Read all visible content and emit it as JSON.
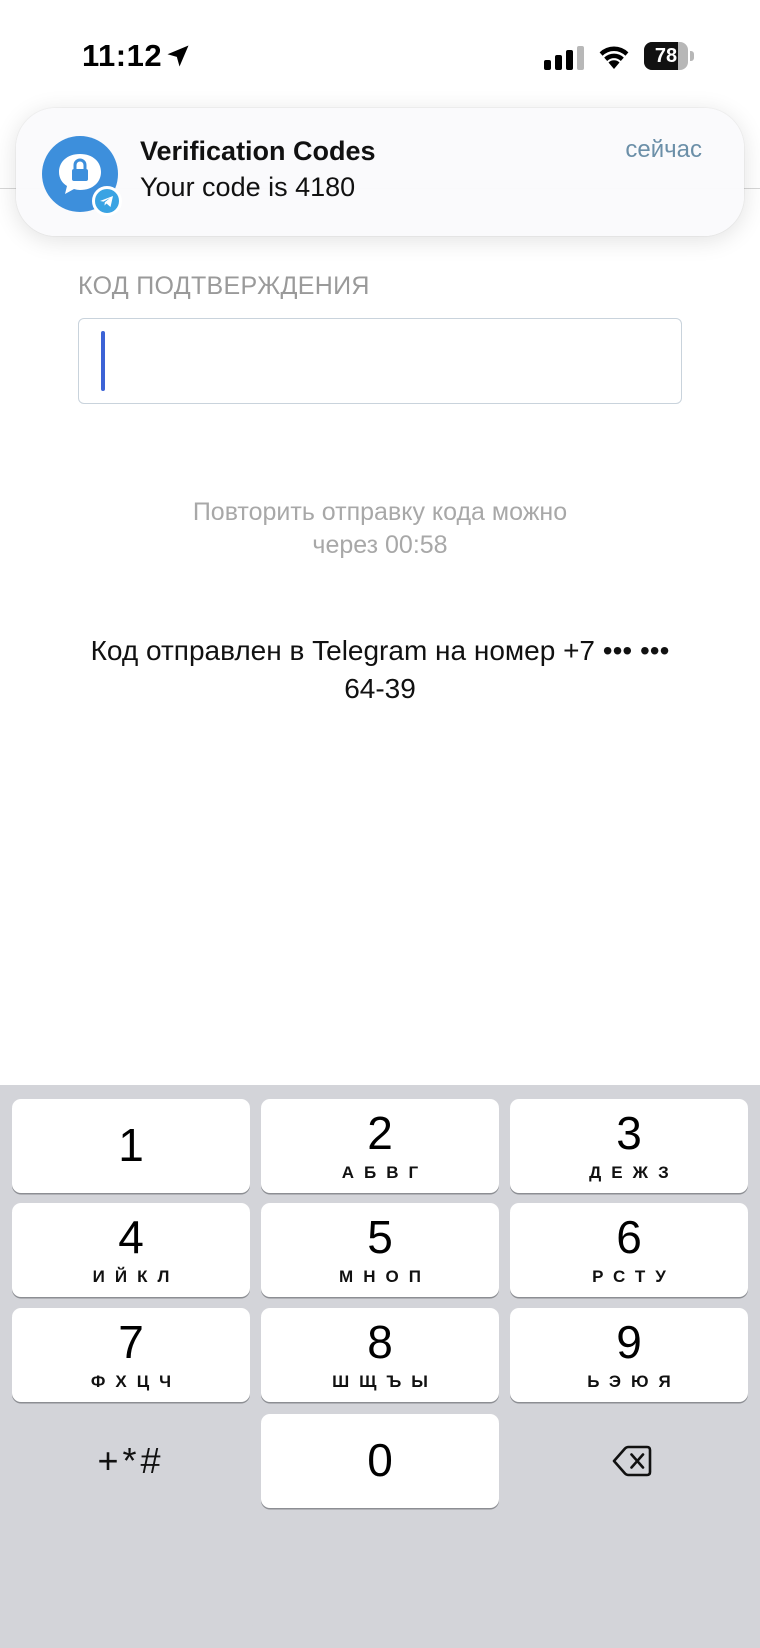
{
  "status_bar": {
    "time": "11:12",
    "battery": "78",
    "battery_level": 0.78,
    "icons": [
      "location-arrow-icon",
      "signal-icon",
      "wifi-icon",
      "battery-icon"
    ]
  },
  "notification": {
    "app_icon": "lock-chat-icon",
    "badge_icon": "telegram-icon",
    "title": "Verification Codes",
    "body": "Your code is 4180",
    "time": "сейчас"
  },
  "form": {
    "code_label": "КОД ПОДТВЕРЖДЕНИЯ",
    "code_value": "",
    "resend_line1": "Повторить отправку кода можно",
    "resend_line2": "через 00:58",
    "sent_line1": "Код отправлен в Telegram на номер +7 ••• •••",
    "sent_line2": "64-39"
  },
  "keypad": {
    "keys": [
      {
        "digit": "1",
        "letters": ""
      },
      {
        "digit": "2",
        "letters": "АБВГ"
      },
      {
        "digit": "3",
        "letters": "ДЕЖЗ"
      },
      {
        "digit": "4",
        "letters": "ИЙКЛ"
      },
      {
        "digit": "5",
        "letters": "МНОП"
      },
      {
        "digit": "6",
        "letters": "РСТУ"
      },
      {
        "digit": "7",
        "letters": "ФХЦЧ"
      },
      {
        "digit": "8",
        "letters": "ШЩЪЫ"
      },
      {
        "digit": "9",
        "letters": "ЬЭЮЯ"
      },
      {
        "digit": "0",
        "letters": ""
      }
    ],
    "symbols": "+*#",
    "delete_icon": "delete-backspace-icon"
  },
  "colors": {
    "accent": "#3c63d6",
    "telegram_blue": "#3d8fdc",
    "keypad_bg": "#d3d4d9"
  }
}
